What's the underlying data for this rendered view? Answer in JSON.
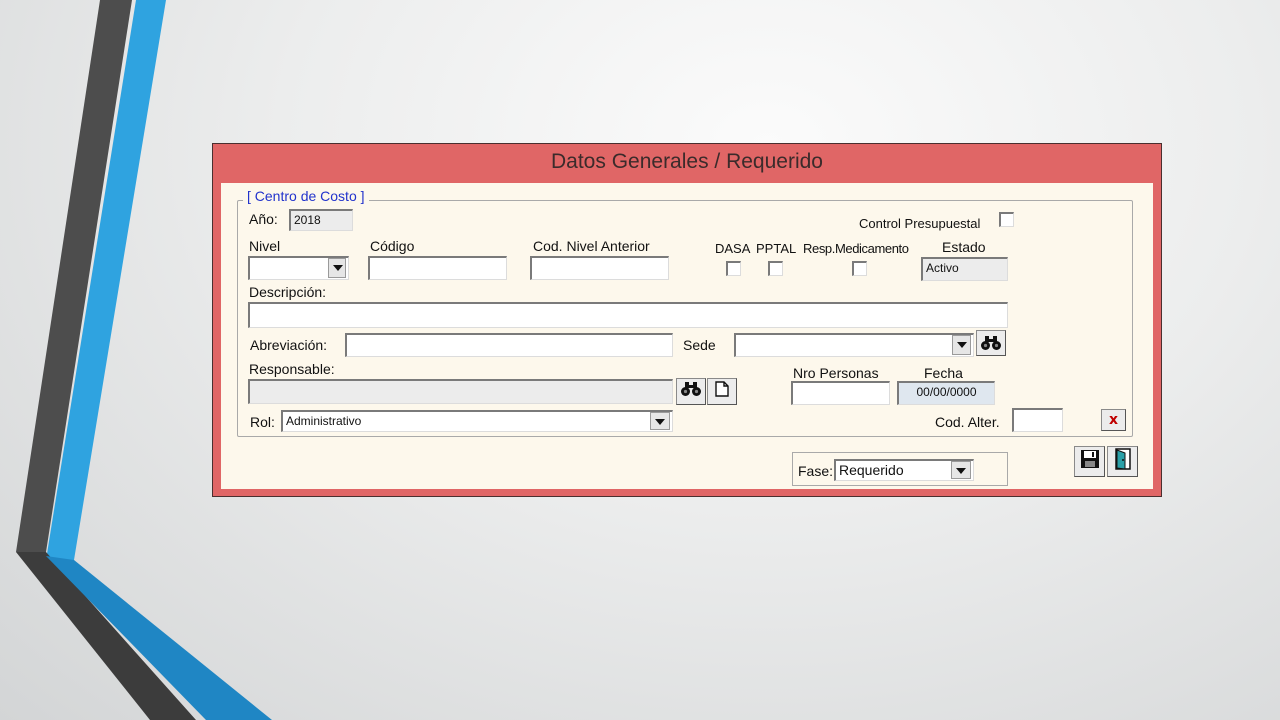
{
  "window": {
    "title": "Datos Generales / Requerido"
  },
  "group": {
    "legend": "[ Centro de Costo ]"
  },
  "fields": {
    "anio": {
      "label": "Año:",
      "value": "2018"
    },
    "control_presupuestal": {
      "label": "Control Presupuestal",
      "checked": false
    },
    "nivel": {
      "label": "Nivel",
      "value": ""
    },
    "codigo": {
      "label": "Código",
      "value": ""
    },
    "cod_nivel_anterior": {
      "label": "Cod. Nivel Anterior",
      "value": ""
    },
    "dasa": {
      "label": "DASA",
      "checked": false
    },
    "pptal": {
      "label": "PPTAL",
      "checked": false
    },
    "resp_medicamento": {
      "label": "Resp.Medicamento",
      "checked": false
    },
    "estado": {
      "label": "Estado",
      "value": "Activo"
    },
    "descripcion": {
      "label": "Descripción:",
      "value": ""
    },
    "abreviacion": {
      "label": "Abreviación:",
      "value": ""
    },
    "sede": {
      "label": "Sede",
      "value": ""
    },
    "responsable": {
      "label": "Responsable:",
      "value": ""
    },
    "nro_personas": {
      "label": "Nro Personas",
      "value": ""
    },
    "fecha": {
      "label": "Fecha",
      "value": "00/00/0000"
    },
    "rol": {
      "label": "Rol:",
      "value": "Administrativo"
    },
    "cod_alter": {
      "label": "Cod. Alter.",
      "value": ""
    },
    "fase": {
      "label": "Fase:",
      "value": "Requerido"
    }
  },
  "buttons": {
    "clear_label": "x"
  },
  "icons": {
    "search": "binoculars-icon",
    "new": "new-document-icon",
    "save": "floppy-disk-icon",
    "exit": "exit-door-icon"
  },
  "colors": {
    "title_bar": "#e06666",
    "panel": "#fdf8ec",
    "legend_text": "#2233cc",
    "slide_blue": "#2fa3e0",
    "slide_dark": "#4a4a4a"
  }
}
